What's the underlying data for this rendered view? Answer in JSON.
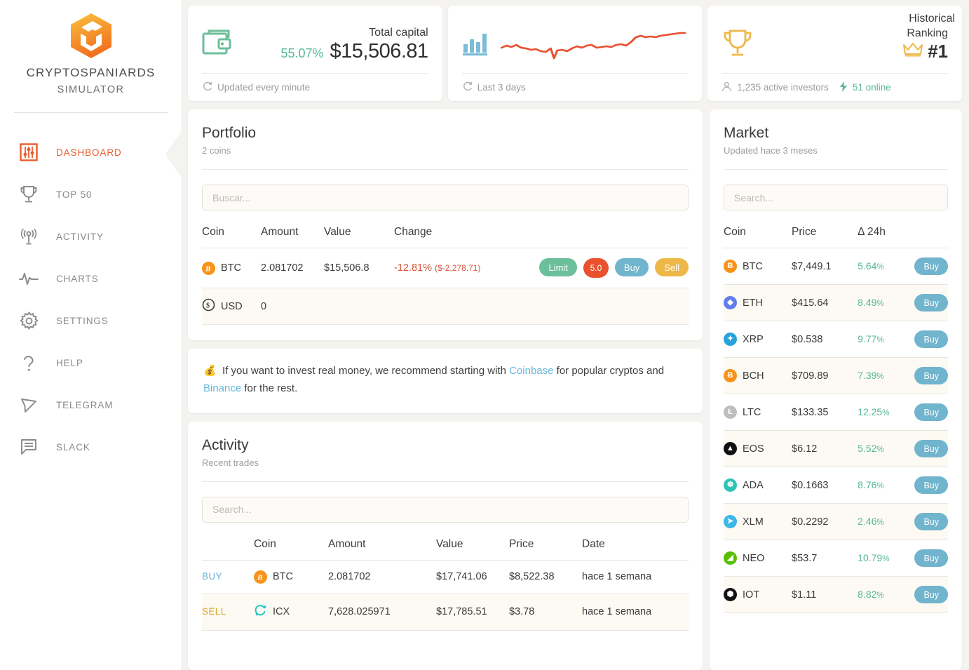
{
  "brand": {
    "name": "CRYPTOSPANIARDS",
    "sub": "SIMULATOR",
    "logo_color": "#f5a03c"
  },
  "sidebar": {
    "items": [
      {
        "label": "DASHBOARD",
        "icon": "sliders-icon",
        "active": true
      },
      {
        "label": "TOP 50",
        "icon": "trophy-icon",
        "active": false
      },
      {
        "label": "ACTIVITY",
        "icon": "broadcast-icon",
        "active": false
      },
      {
        "label": "CHARTS",
        "icon": "pulse-icon",
        "active": false
      },
      {
        "label": "SETTINGS",
        "icon": "gear-icon",
        "active": false
      },
      {
        "label": "HELP",
        "icon": "question-icon",
        "active": false
      },
      {
        "label": "TELEGRAM",
        "icon": "paper-plane-icon",
        "active": false
      },
      {
        "label": "SLACK",
        "icon": "chat-icon",
        "active": false
      }
    ],
    "active_color": "#ea5c2b",
    "inactive_color": "#8a8a8a"
  },
  "stats": {
    "capital": {
      "title": "Total capital",
      "percent": "55.07%",
      "value": "$15,506.81",
      "footer": "Updated every minute",
      "icon": "wallet-icon",
      "icon_color": "#6cbf9b",
      "percent_color": "#57b894"
    },
    "historical": {
      "title": "Historical",
      "footer": "Last 3 days",
      "icon": "bar-chart-icon",
      "icon_color": "#7cbcd6",
      "line_color": "#e8502e"
    },
    "ranking": {
      "title": "Ranking",
      "value": "#1",
      "investors": "1,235 active investors",
      "online": "51 online",
      "icon": "trophy-icon",
      "icon_color": "#eeb849",
      "online_color": "#57b894"
    }
  },
  "portfolio": {
    "title": "Portfolio",
    "subtitle": "2 coins",
    "search_placeholder": "Buscar...",
    "search_value": "",
    "columns": [
      "Coin",
      "Amount",
      "Value",
      "Change"
    ],
    "rows": [
      {
        "coin": "BTC",
        "coin_color": "#f7931a",
        "coin_glyph": "Ƀ",
        "amount": "2.081702",
        "value": "$15,506.8",
        "change": "-12.81%",
        "change_abs": "($-2,278.71)",
        "actions": [
          "Limit",
          "5.0",
          "Buy",
          "Sell"
        ]
      },
      {
        "coin": "USD",
        "coin_color": "#3c3c3c",
        "coin_glyph": "$",
        "amount": "0",
        "value": "",
        "change": "",
        "change_abs": "",
        "actions": []
      }
    ]
  },
  "banner": {
    "icon": "money-bag-icon",
    "text_1": "If you want to invest real money, we recommend starting with ",
    "link_1": "Coinbase",
    "text_2": " for popular cryptos and ",
    "link_2": "Binance",
    "text_3": " for the rest.",
    "link_color": "#64b8dd"
  },
  "activity": {
    "title": "Activity",
    "subtitle": "Recent trades",
    "search_placeholder": "Search...",
    "search_value": "",
    "columns": [
      "",
      "Coin",
      "Amount",
      "Value",
      "Price",
      "Date"
    ],
    "rows": [
      {
        "side": "BUY",
        "side_color": "#69b6d6",
        "coin": "BTC",
        "coin_color": "#f7931a",
        "coin_glyph": "Ƀ",
        "amount": "2.081702",
        "value": "$17,741.06",
        "price": "$8,522.38",
        "date": "hace 1 semana"
      },
      {
        "side": "SELL",
        "side_color": "#d9a227",
        "coin": "ICX",
        "coin_color": "#2ec6c6",
        "coin_glyph": "◌",
        "amount": "7,628.025971",
        "value": "$17,785.51",
        "price": "$3.78",
        "date": "hace 1 semana"
      }
    ]
  },
  "market": {
    "title": "Market",
    "subtitle": "Updated hace 3 meses",
    "search_placeholder": "Search...",
    "search_value": "",
    "columns": [
      "Coin",
      "Price",
      "Δ 24h",
      ""
    ],
    "buy_label": "Buy",
    "rows": [
      {
        "coin": "BTC",
        "price": "$7,449.1",
        "change": "5.64%",
        "color": "#f7931a",
        "glyph": "Ƀ"
      },
      {
        "coin": "ETH",
        "price": "$415.64",
        "change": "8.49%",
        "color": "#627eea",
        "glyph": "◆"
      },
      {
        "coin": "XRP",
        "price": "$0.538",
        "change": "9.77%",
        "color": "#27a2db",
        "glyph": "✦"
      },
      {
        "coin": "BCH",
        "price": "$709.89",
        "change": "7.39%",
        "color": "#f7931a",
        "glyph": "Ƀ"
      },
      {
        "coin": "LTC",
        "price": "$133.35",
        "change": "12.25%",
        "color": "#bebebe",
        "glyph": "Ł"
      },
      {
        "coin": "EOS",
        "price": "$6.12",
        "change": "5.52%",
        "color": "#101010",
        "glyph": "▲"
      },
      {
        "coin": "ADA",
        "price": "$0.1663",
        "change": "8.76%",
        "color": "#2ec4b6",
        "glyph": "☸"
      },
      {
        "coin": "XLM",
        "price": "$0.2292",
        "change": "2.46%",
        "color": "#3bb7e8",
        "glyph": "➤"
      },
      {
        "coin": "NEO",
        "price": "$53.7",
        "change": "10.79%",
        "color": "#58bf00",
        "glyph": "◢"
      },
      {
        "coin": "IOT",
        "price": "$1.11",
        "change": "8.82%",
        "color": "#131313",
        "glyph": "⬢"
      }
    ],
    "change_color": "#57b894"
  }
}
